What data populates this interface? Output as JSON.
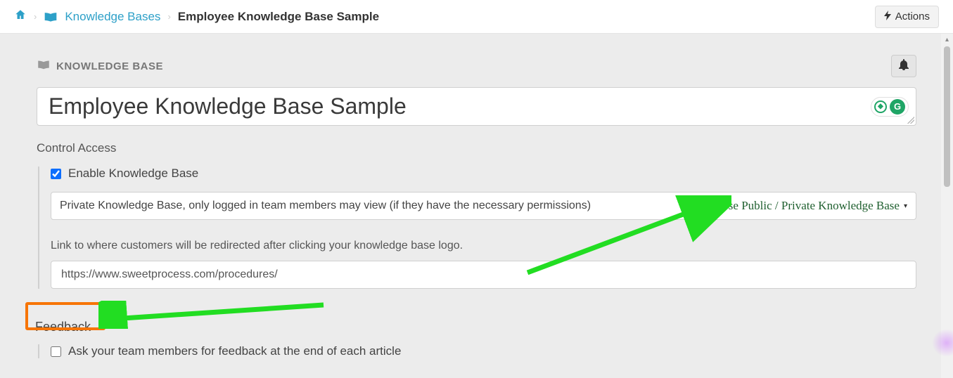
{
  "breadcrumb": {
    "kb_link": "Knowledge Bases",
    "current": "Employee Knowledge Base Sample"
  },
  "actions_label": "Actions",
  "section": {
    "title": "KNOWLEDGE BASE"
  },
  "title_input_value": "Employee Knowledge Base Sample",
  "control_access_label": "Control Access",
  "enable_kb": {
    "label": "Enable Knowledge Base",
    "checked": true
  },
  "visibility_select": {
    "value": "Private Knowledge Base, only logged in team members may view (if they have the necessary permissions)",
    "annotation": "Choose Public / Private Knowledge Base"
  },
  "logo_link": {
    "hint": "Link to where customers will be redirected after clicking your knowledge base logo.",
    "value": "https://www.sweetprocess.com/procedures/"
  },
  "feedback": {
    "heading": "Feedback",
    "ask_label": "Ask your team members for feedback at the end of each article",
    "ask_checked": false
  },
  "grammarly": {
    "small_glyph": "◆",
    "big_glyph": "G"
  }
}
